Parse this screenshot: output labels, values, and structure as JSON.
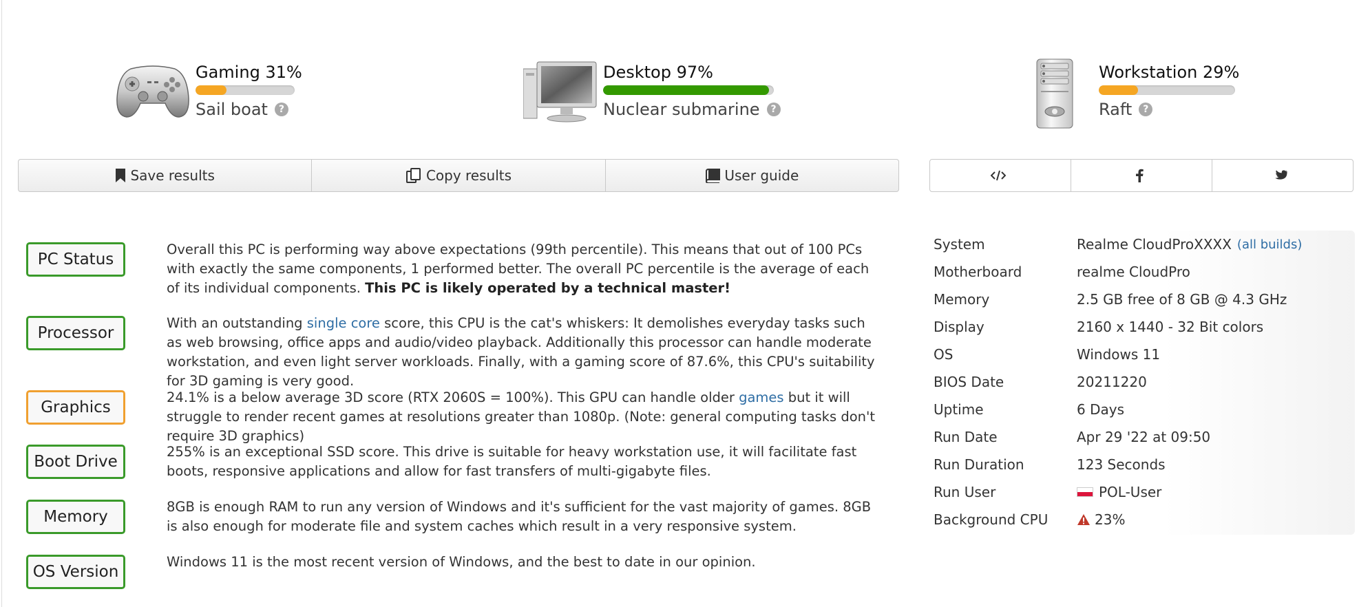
{
  "scores": [
    {
      "title": "Gaming 31%",
      "level": 0.31,
      "sub": "Sail boat",
      "color": "#f5a623",
      "icon": "gamepad-icon"
    },
    {
      "title": "Desktop 97%",
      "level": 0.97,
      "sub": "Nuclear submarine",
      "color": "#339900",
      "icon": "desktop-computer-icon"
    },
    {
      "title": "Workstation 29%",
      "level": 0.29,
      "sub": "Raft",
      "color": "#f5a623",
      "icon": "workstation-tower-icon"
    }
  ],
  "toolbar": {
    "save": "Save results",
    "copy": "Copy results",
    "guide": "User guide"
  },
  "social": {
    "embed_icon": "code-icon",
    "facebook_icon": "facebook-icon",
    "twitter_icon": "twitter-icon"
  },
  "status": [
    {
      "label": "PC Status",
      "color": "green",
      "parts": [
        "Overall this PC is performing way above expectations (99th percentile). This means that out of 100 PCs with exactly the same components, 1 performed better. The overall PC percentile is the average of each of its individual components. ",
        "This PC is likely operated by a technical master!"
      ]
    },
    {
      "label": "Processor",
      "color": "green",
      "parts": [
        "With an outstanding ",
        "single core",
        " score, this CPU is the cat's whiskers: It demolishes everyday tasks such as web browsing, office apps and audio/video playback. Additionally this processor can handle moderate workstation, and even light server workloads. Finally, with a gaming score of 87.6%, this CPU's suitability for 3D gaming is very good."
      ]
    },
    {
      "label": "Graphics",
      "color": "orange",
      "parts": [
        "24.1% is a below average 3D score (RTX 2060S = 100%). This GPU can handle older ",
        "games",
        " but it will struggle to render recent games at resolutions greater than 1080p. (Note: general computing tasks don't require 3D graphics)"
      ]
    },
    {
      "label": "Boot Drive",
      "color": "green",
      "text": "255% is an exceptional SSD score. This drive is suitable for heavy workstation use, it will facilitate fast boots, responsive applications and allow for fast transfers of multi-gigabyte files."
    },
    {
      "label": "Memory",
      "color": "green",
      "text": "8GB is enough RAM to run any version of Windows and it's sufficient for the vast majority of games. 8GB is also enough for moderate file and system caches which result in a very responsive system."
    },
    {
      "label": "OS Version",
      "color": "green",
      "text": "Windows 11 is the most recent version of Windows, and the best to date in our opinion."
    }
  ],
  "system": {
    "rows": [
      {
        "k": "System",
        "v": "Realme CloudProXXXX",
        "link": "(all builds)"
      },
      {
        "k": "Motherboard",
        "v": "realme CloudPro"
      },
      {
        "k": "Memory",
        "v": "2.5 GB free of 8 GB @ 4.3 GHz"
      },
      {
        "k": "Display",
        "v": "2160 x 1440 - 32 Bit colors"
      },
      {
        "k": "OS",
        "v": "Windows 11"
      },
      {
        "k": "BIOS Date",
        "v": "20211220"
      },
      {
        "k": "Uptime",
        "v": "6 Days"
      },
      {
        "k": "Run Date",
        "v": "Apr 29 '22 at 09:50"
      },
      {
        "k": "Run Duration",
        "v": "123 Seconds"
      },
      {
        "k": "Run User",
        "v": "POL-User",
        "icon": "poland-flag-icon"
      },
      {
        "k": "Background CPU",
        "v": "23%",
        "icon": "warning-icon"
      }
    ]
  },
  "colors": {
    "link": "#2e6da4",
    "green_badge": "#3a9a2a",
    "orange_badge": "#f0a030"
  }
}
